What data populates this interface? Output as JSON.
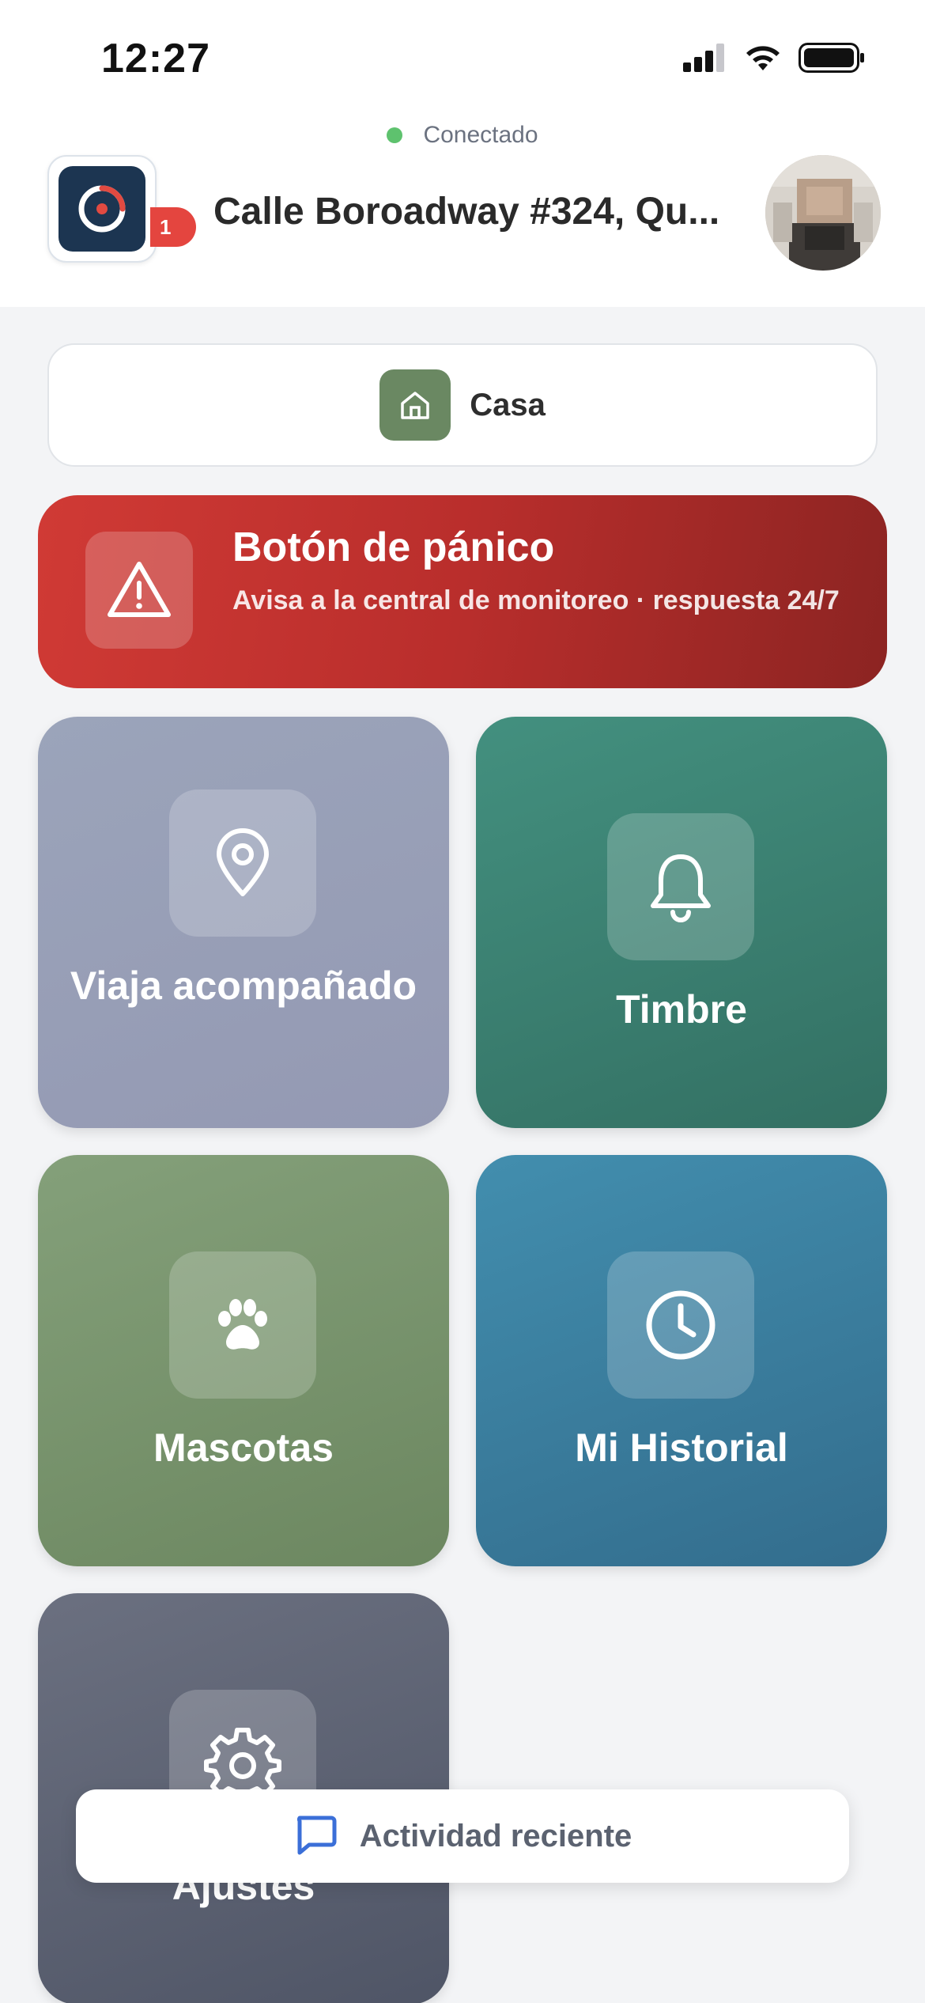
{
  "status_bar": {
    "time": "12:27"
  },
  "connection": {
    "status_text": "Conectado",
    "status_color": "#5ec26e"
  },
  "header": {
    "address": "Calle Boroadway #324, Qu...",
    "notification_count": "1",
    "logo_icon": "app-logo-icon",
    "avatar_icon": "user-avatar"
  },
  "property_selector": {
    "label": "Casa",
    "icon": "home-icon",
    "icon_color": "#6a8862"
  },
  "panic": {
    "title": "Botón de pánico",
    "subtitle": "Avisa a la central de monitoreo · respuesta 24/7",
    "icon": "warning-triangle-icon",
    "color": "#c8332f"
  },
  "tiles": [
    {
      "label": "Viaja acompañado",
      "icon": "map-pin-icon",
      "color": "#9ba0b8"
    },
    {
      "label": "Timbre",
      "icon": "bell-icon",
      "color": "#3d8072"
    },
    {
      "label": "Mascotas",
      "icon": "paw-icon",
      "color": "#78946d"
    },
    {
      "label": "Mi Historial",
      "icon": "clock-icon",
      "color": "#3b7e9e"
    },
    {
      "label": "Ajustes",
      "icon": "gear-icon",
      "color": "#5d6273"
    }
  ],
  "recent_activity": {
    "label": "Actividad reciente",
    "icon": "chat-bubble-icon",
    "icon_color": "#3b6fd8"
  }
}
